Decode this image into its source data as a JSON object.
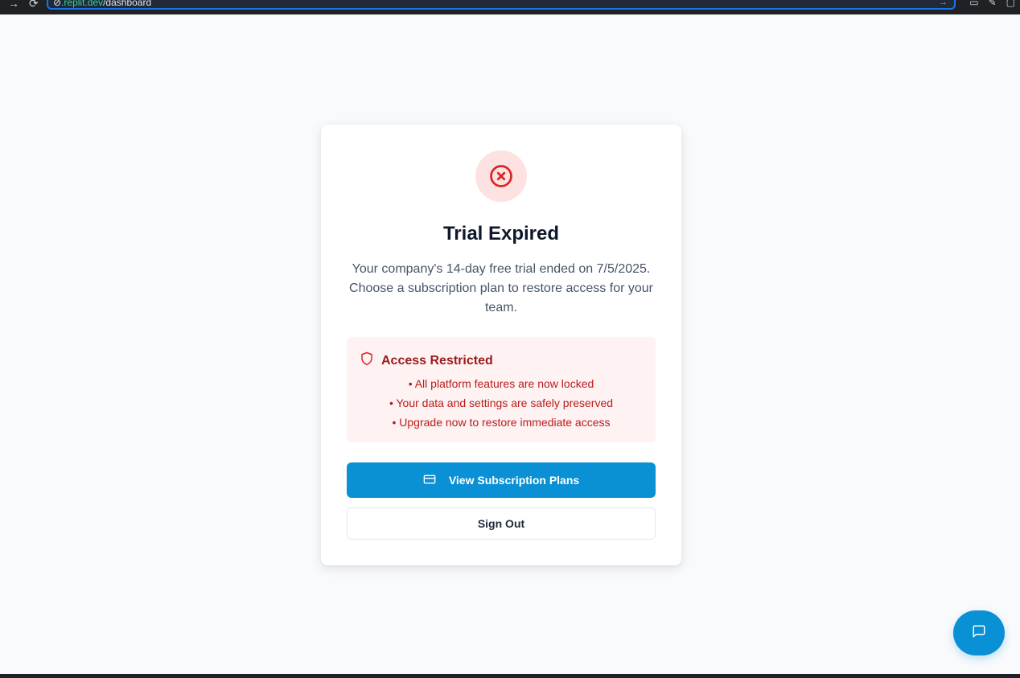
{
  "browser": {
    "url_host": ".replit.dev",
    "url_path": "/dashboard"
  },
  "trial": {
    "title": "Trial Expired",
    "message": "Your company's 14-day free trial ended on 7/5/2025. Choose a subscription plan to restore access for your team.",
    "status_icon": "x-circle-icon"
  },
  "alert": {
    "title": "Access Restricted",
    "icon": "shield-icon",
    "items": [
      "• All platform features are now locked",
      "• Your data and settings are safely preserved",
      "• Upgrade now to restore immediate access"
    ]
  },
  "actions": {
    "primary_label": "View Subscription Plans",
    "primary_icon": "credit-card-icon",
    "secondary_label": "Sign Out"
  },
  "chat": {
    "icon": "message-square-icon"
  },
  "colors": {
    "primary": "#0a90d4",
    "danger": "#dc2626",
    "danger_bg": "#fee2e2",
    "alert_bg": "#fef2f2",
    "alert_text": "#b91c1c",
    "page_bg": "#f8fafc"
  }
}
